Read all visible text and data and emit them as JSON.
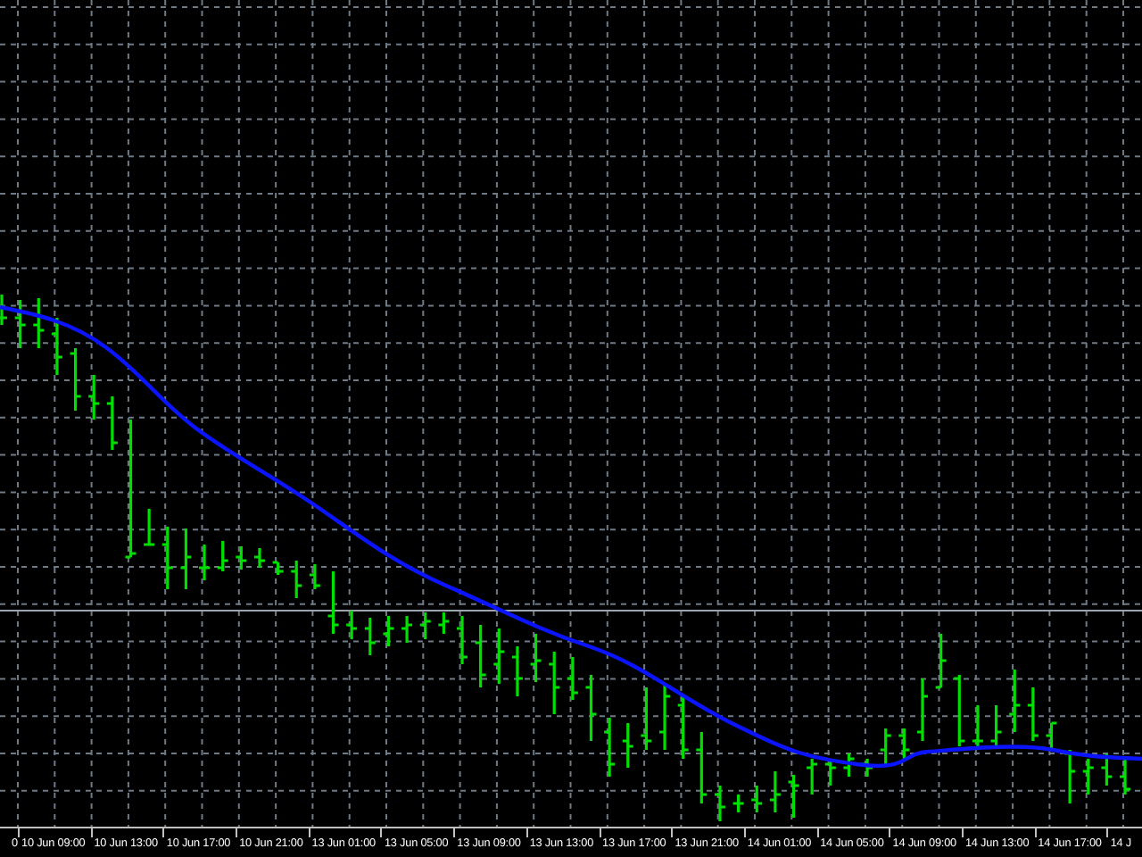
{
  "chart": {
    "time_axis": {
      "labels": [
        "0",
        "10 Jun 09:00",
        "10 Jun 13:00",
        "10 Jun 17:00",
        "10 Jun 21:00",
        "13 Jun 01:00",
        "13 Jun 05:00",
        "13 Jun 09:00",
        "13 Jun 13:00",
        "13 Jun 17:00",
        "13 Jun 21:00",
        "14 Jun 01:00",
        "14 Jun 05:00",
        "14 Jun 09:00",
        "14 Jun 13:00",
        "14 Jun 17:00",
        "14 J"
      ]
    }
  }
}
